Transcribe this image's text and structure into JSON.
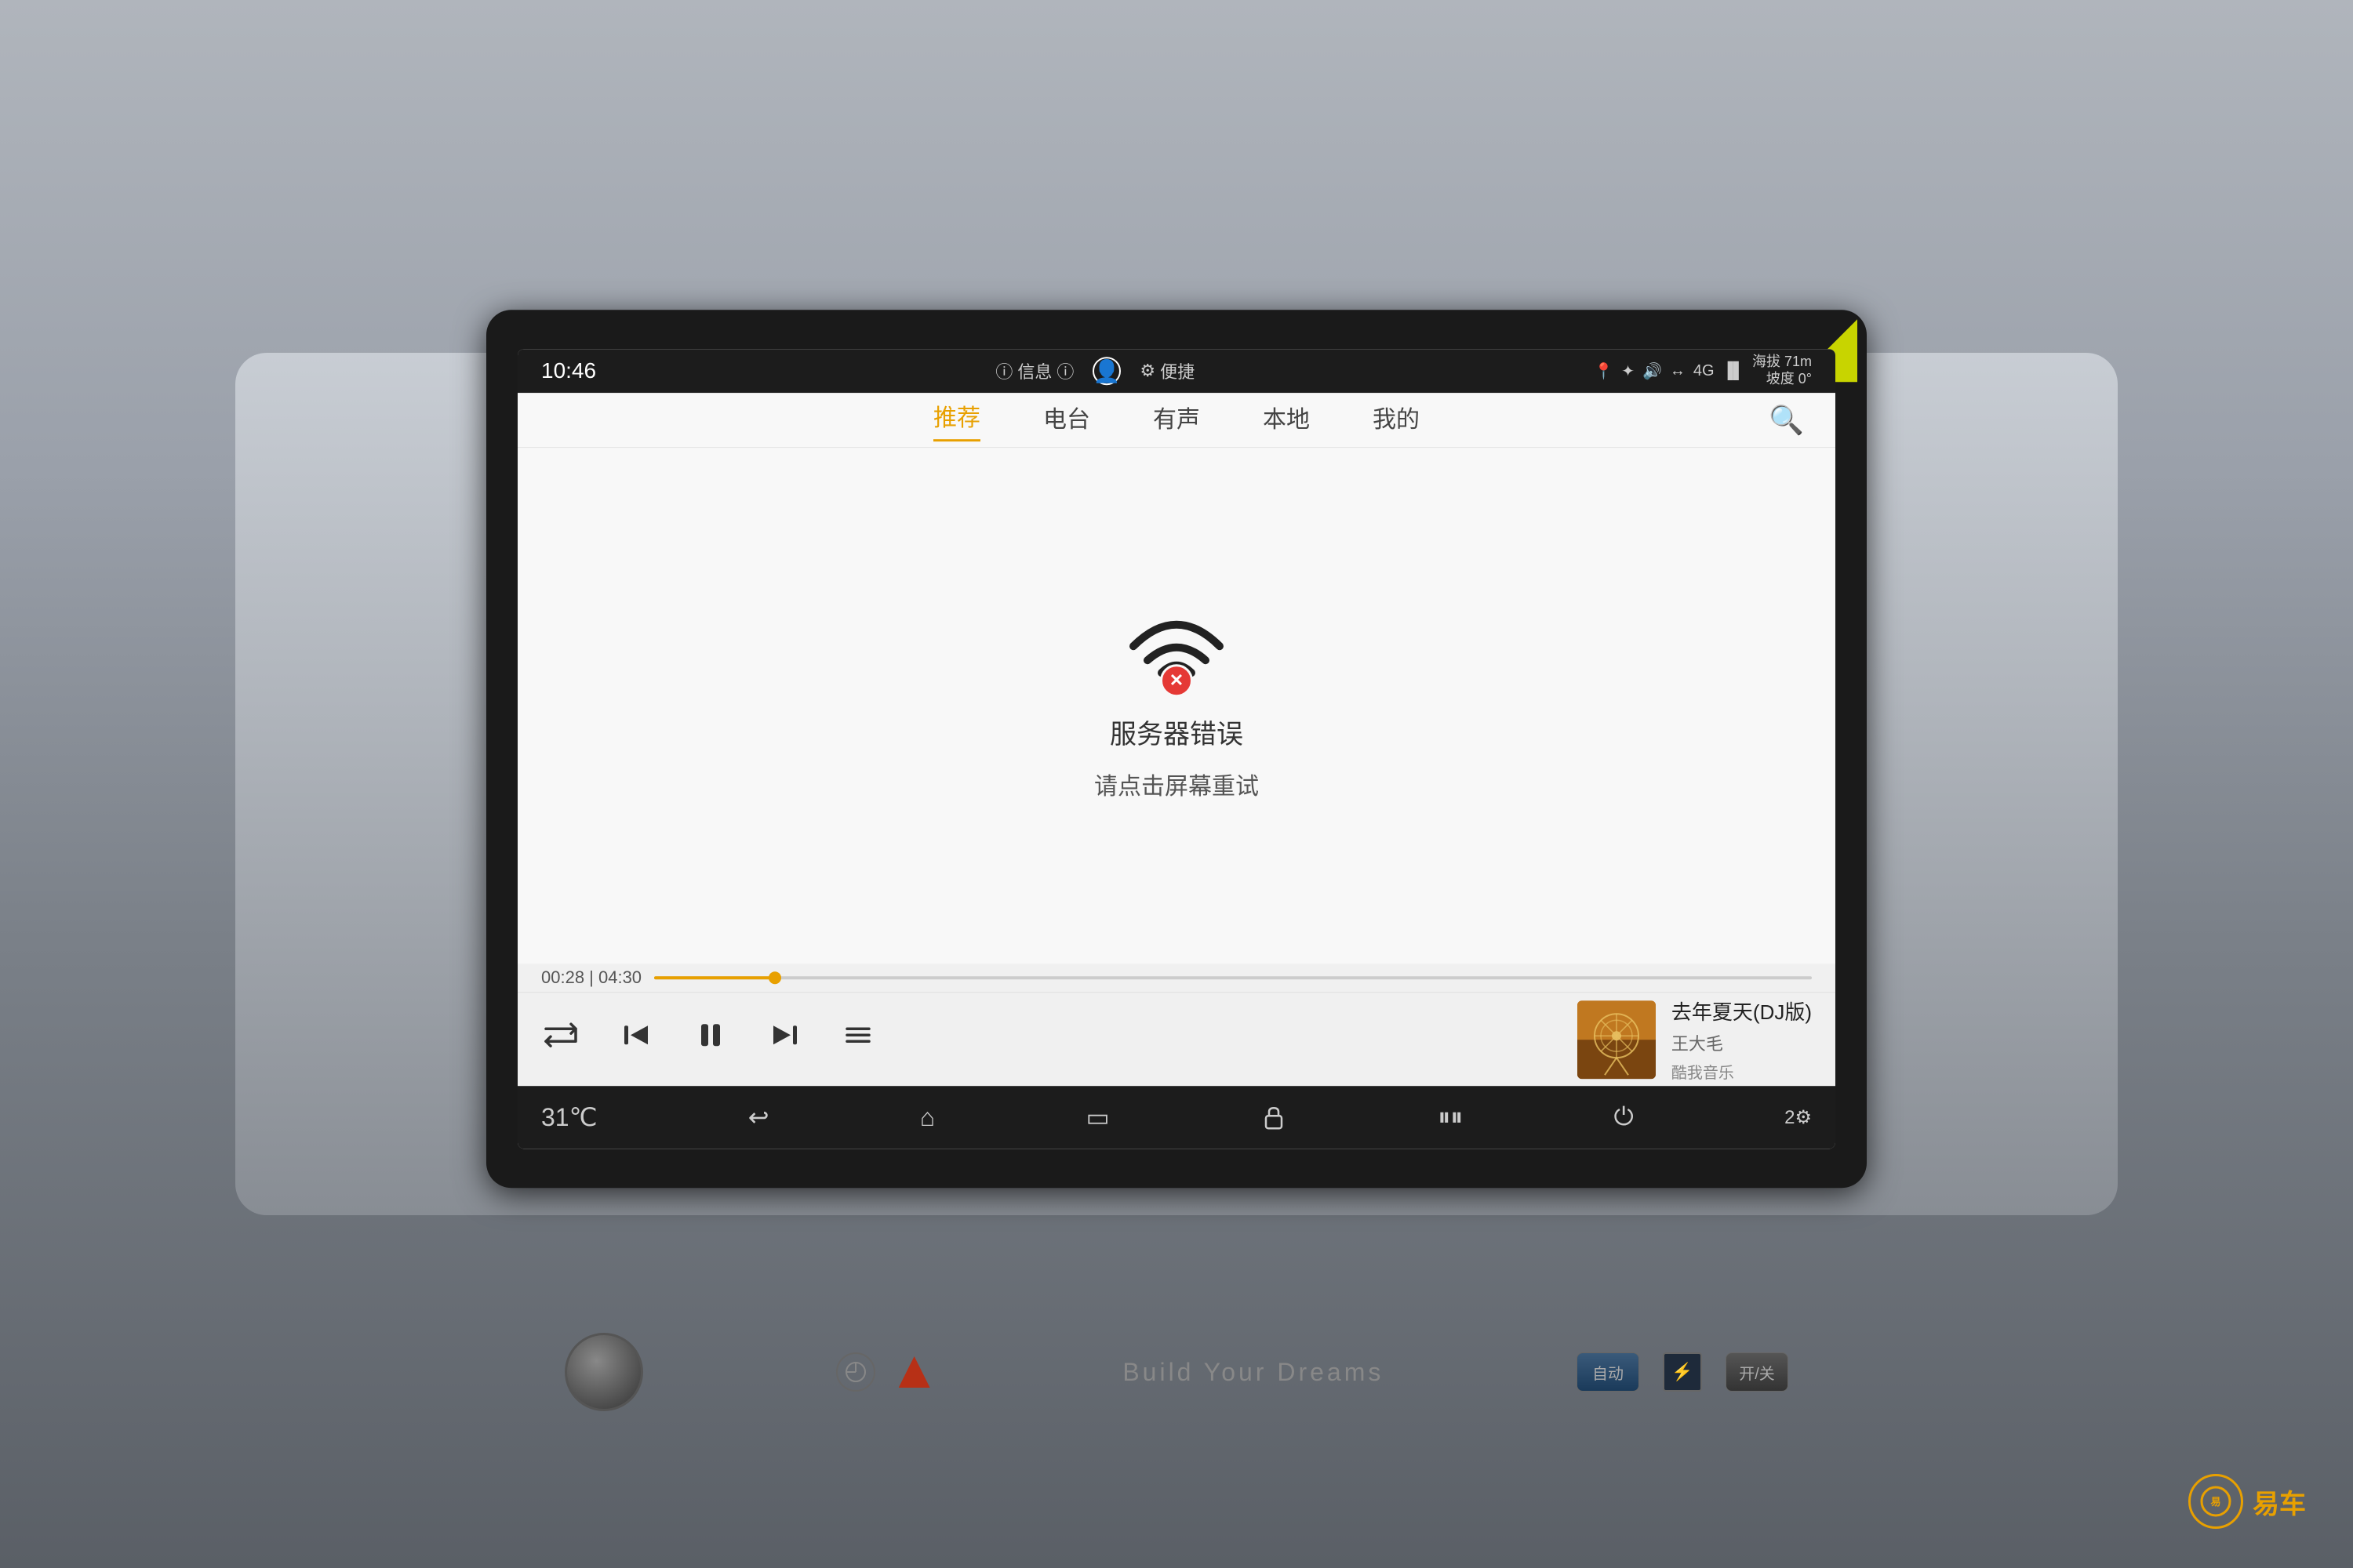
{
  "device": {
    "background_color": "#6a6a6a"
  },
  "status_bar": {
    "time": "10:46",
    "nav_items": [
      {
        "label": "ⓘ",
        "text": "信息",
        "icon": "ⓘ"
      },
      {
        "label": "👤",
        "text": "",
        "icon": "👤"
      },
      {
        "label": "⚙",
        "text": "便捷",
        "icon": "⚙"
      }
    ],
    "icons": {
      "location": "📍",
      "bluetooth": "✦",
      "volume": "🔊",
      "signal": "↔",
      "lte": "4G",
      "bars": "|||"
    },
    "altitude": "海拔 71m",
    "slope": "坡度 0°"
  },
  "tabs": {
    "items": [
      {
        "label": "推荐",
        "active": true
      },
      {
        "label": "电台",
        "active": false
      },
      {
        "label": "有声",
        "active": false
      },
      {
        "label": "本地",
        "active": false
      },
      {
        "label": "我的",
        "active": false
      }
    ],
    "search_icon": "🔍"
  },
  "error_state": {
    "title": "服务器错误",
    "subtitle": "请点击屏幕重试",
    "wifi_icon": "wifi-error",
    "error_icon": "✕"
  },
  "player": {
    "current_time": "00:28",
    "total_time": "04:30",
    "time_display": "00:28 | 04:30",
    "progress_percent": 10.4,
    "song_title": "去年夏天(DJ版)",
    "artist": "王大毛",
    "platform": "酷我音乐",
    "controls": {
      "repeat": "↻",
      "prev": "⏮",
      "pause": "⏸",
      "next": "⏭",
      "playlist": "≡"
    }
  },
  "system_bar": {
    "temperature": "31℃",
    "back_icon": "↩",
    "home_icon": "⌂",
    "recent_icon": "▭",
    "lock_icon": "🔒",
    "media_icon": "⏸",
    "power_icon": "⏻",
    "settings_icon": "⚙"
  },
  "physical": {
    "brand": "Build Your Dreams",
    "auto_label": "自动",
    "on_off_label": "开/关",
    "logo": "易车"
  }
}
